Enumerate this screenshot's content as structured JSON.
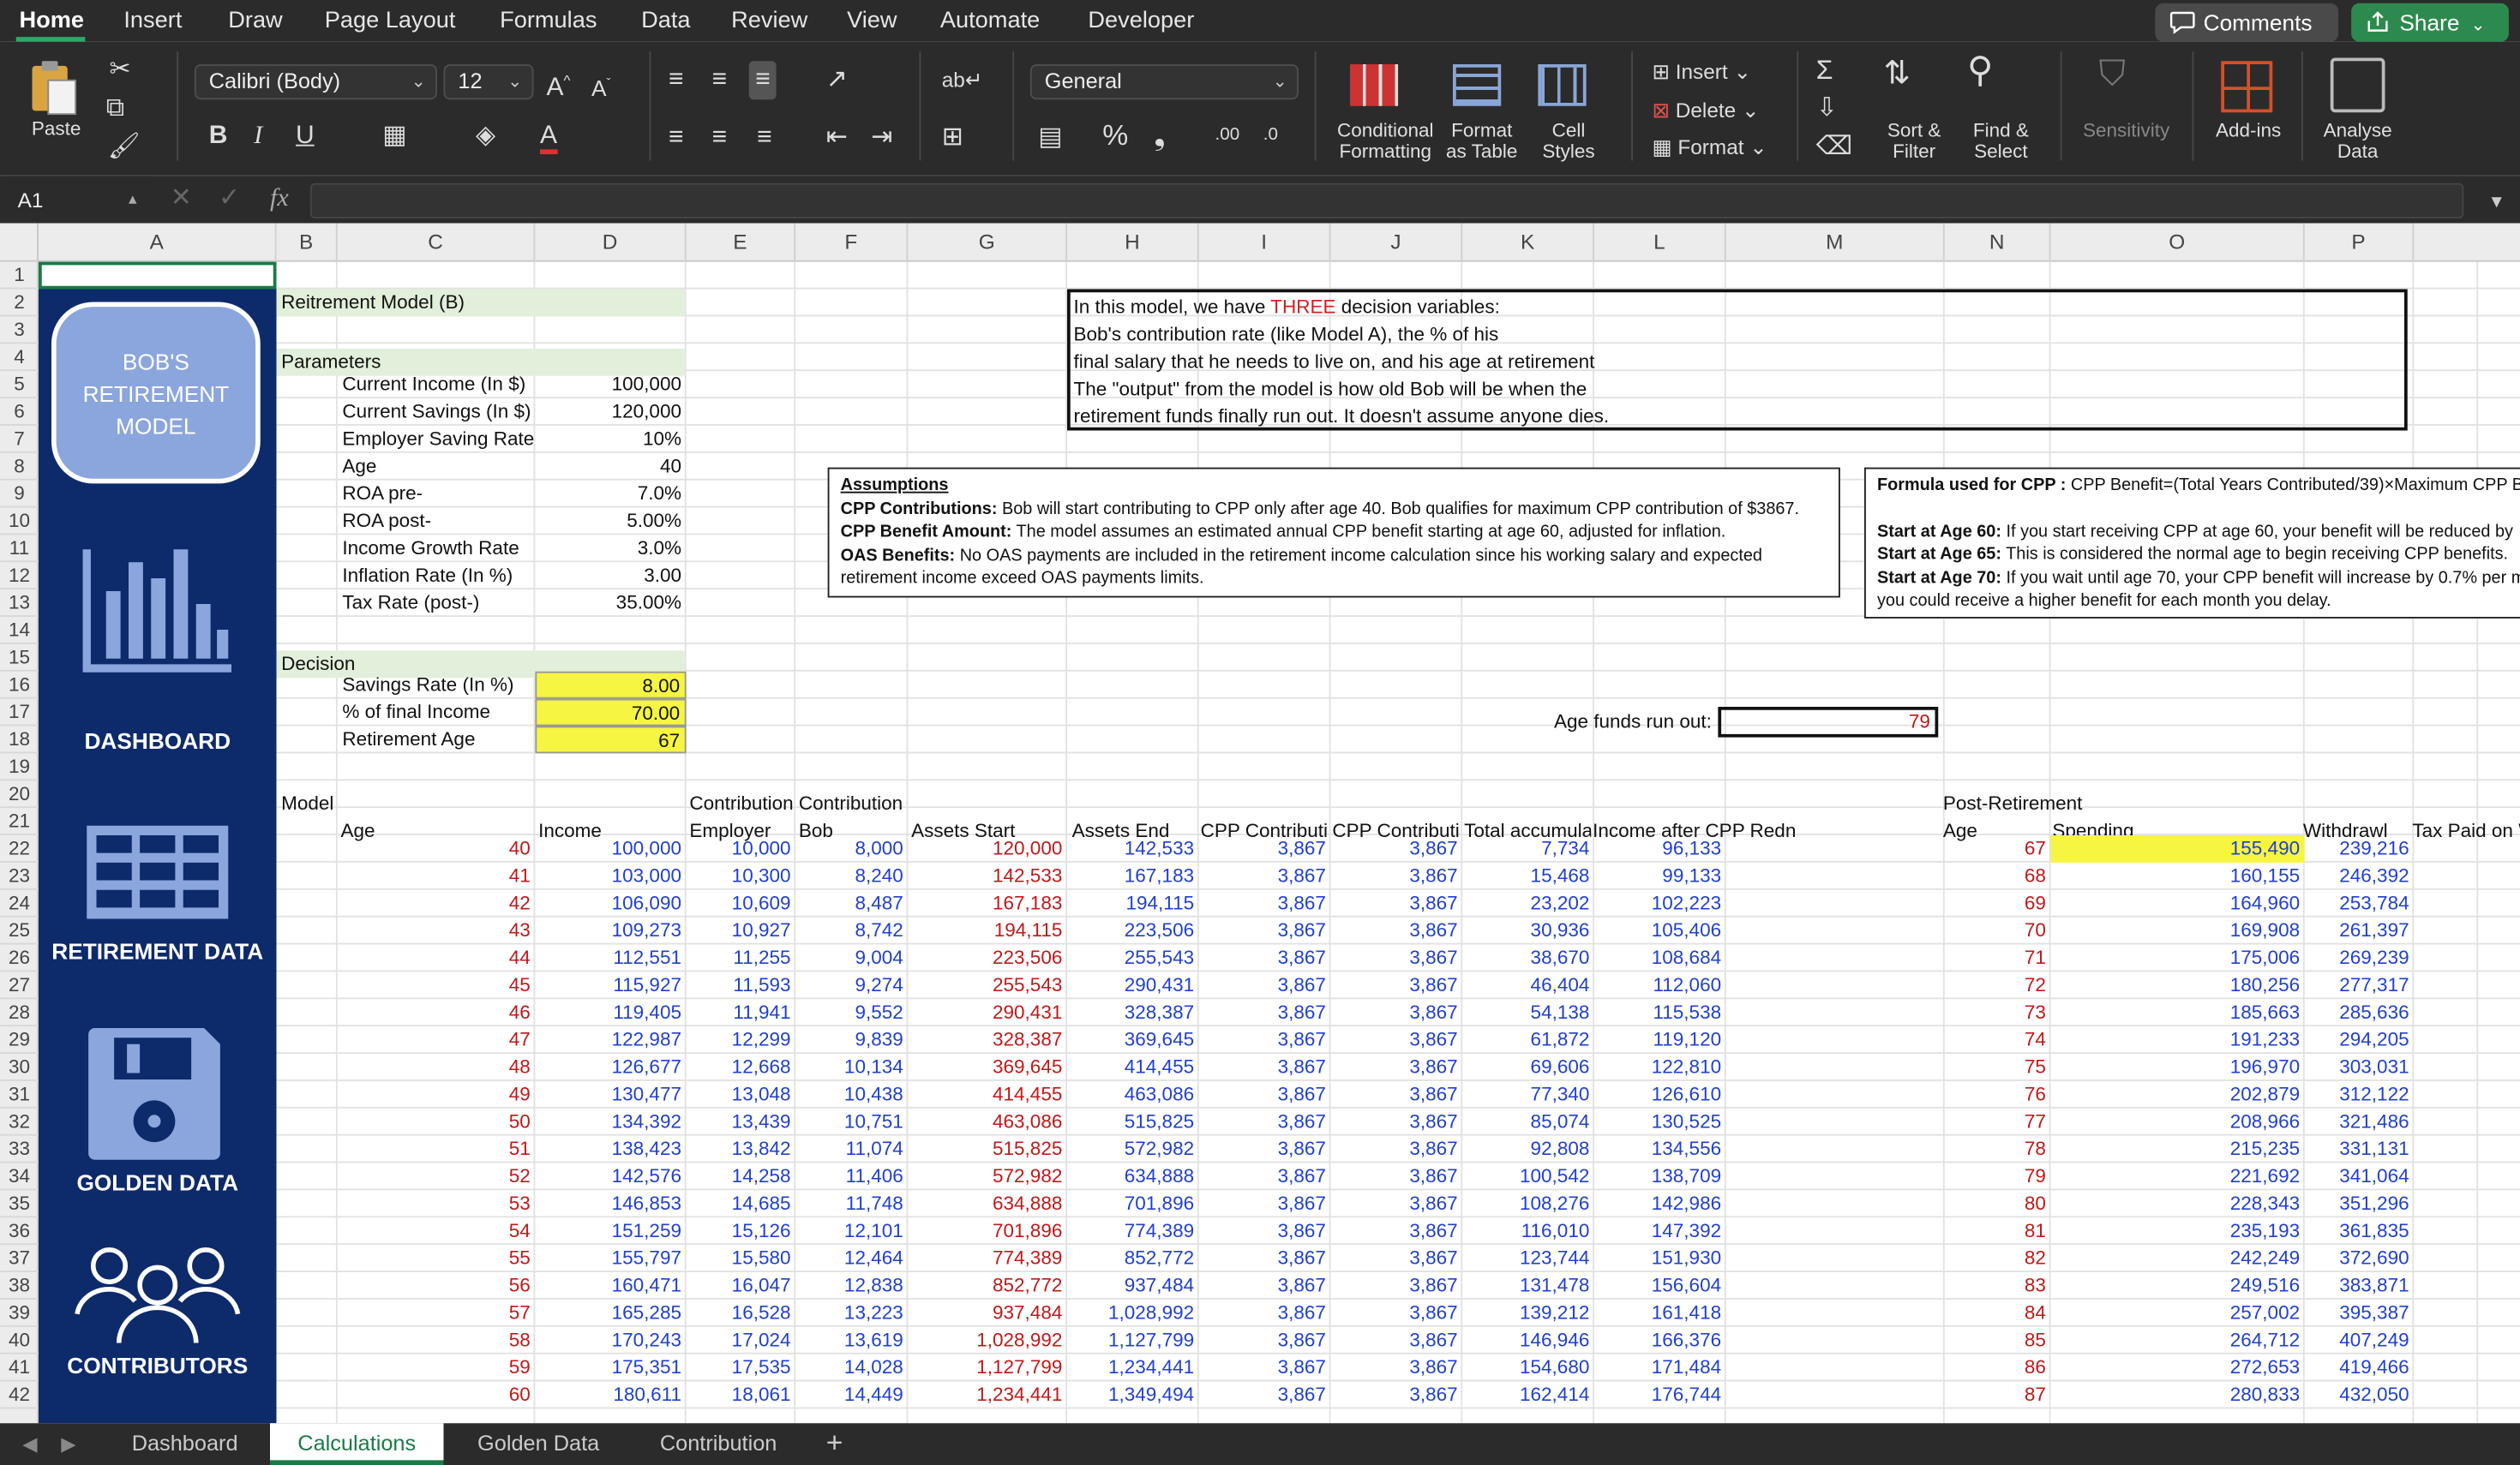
{
  "ribbon_tabs": [
    "Home",
    "Insert",
    "Draw",
    "Page Layout",
    "Formulas",
    "Data",
    "Review",
    "View",
    "Automate",
    "Developer"
  ],
  "top_buttons": {
    "comments": "Comments",
    "share": "Share"
  },
  "ribbon": {
    "paste": "Paste",
    "font_name": "Calibri (Body)",
    "font_size": "12",
    "number_format": "General",
    "cond_fmt": [
      "Conditional",
      "Formatting"
    ],
    "fmt_table": [
      "Format",
      "as Table"
    ],
    "cell_styles": [
      "Cell",
      "Styles"
    ],
    "insert": "Insert",
    "delete": "Delete",
    "format": "Format",
    "sort": [
      "Sort &",
      "Filter"
    ],
    "find": [
      "Find &",
      "Select"
    ],
    "sensitivity": "Sensitivity",
    "addins": "Add-ins",
    "analyse": [
      "Analyse",
      "Data"
    ]
  },
  "formula_bar": {
    "name_box": "A1",
    "fx": "fx",
    "formula": ""
  },
  "columns": [
    "A",
    "B",
    "C",
    "D",
    "E",
    "F",
    "G",
    "H",
    "I",
    "J",
    "K",
    "L",
    "M",
    "N",
    "O",
    "P"
  ],
  "rows": [
    "1",
    "2",
    "3",
    "4",
    "5",
    "6",
    "7",
    "8",
    "9",
    "10",
    "11",
    "12",
    "13",
    "14",
    "15",
    "16",
    "17",
    "18",
    "19",
    "20",
    "21",
    "22",
    "23",
    "24",
    "25",
    "26",
    "27",
    "28",
    "29",
    "30",
    "31",
    "32",
    "33",
    "34",
    "35",
    "36",
    "37",
    "38",
    "39",
    "40",
    "41",
    "42"
  ],
  "sidebar": {
    "title": [
      "BOB'S",
      "RETIREMENT",
      "MODEL"
    ],
    "dashboard": "DASHBOARD",
    "retirement_data": "RETIREMENT DATA",
    "golden_data": "GOLDEN DATA",
    "contributors": "CONTRIBUTORS"
  },
  "model_title": "Reitrement Model (B)",
  "parameters_header": "Parameters",
  "parameters": [
    {
      "label": "Current Income (In $)",
      "value": "100,000"
    },
    {
      "label": "Current Savings (In $)",
      "value": "120,000"
    },
    {
      "label": "Employer Saving Rate",
      "value": "10%"
    },
    {
      "label": "Age",
      "value": "40"
    },
    {
      "label": "ROA pre-",
      "value": "7.0%"
    },
    {
      "label": "ROA post-",
      "value": "5.00%"
    },
    {
      "label": "Income Growth Rate",
      "value": "3.0%"
    },
    {
      "label": "Inflation Rate (In %)",
      "value": "3.00"
    },
    {
      "label": "Tax Rate (post-)",
      "value": "35.00%"
    }
  ],
  "decision_header": "Decision",
  "decisions": [
    {
      "label": "Savings Rate (In %)",
      "value": "8.00"
    },
    {
      "label": "% of final Income",
      "value": "70.00"
    },
    {
      "label": "Retirement Age",
      "value": "67"
    }
  ],
  "note_box": {
    "line1_pre": "In this model, we have ",
    "line1_red": "THREE",
    "line1_post": " decision variables:",
    "lines": [
      "Bob's contribution rate (like Model A), the % of his",
      "final salary that he needs to live on, and his age at retirement",
      "The \"output\" from the model is how old Bob will be when the",
      "retirement funds finally run out. It doesn't assume anyone dies."
    ]
  },
  "assumptions": {
    "title": "Assumptions",
    "cpp_contrib_label": "CPP Contributions:",
    "cpp_contrib": " Bob will start contributing to CPP only after age 40. Bob qualifies for maximum CPP contribution of $3867.",
    "cpp_benefit_label": "CPP Benefit Amount:",
    "cpp_benefit": " The model assumes an estimated annual CPP benefit starting at age 60, adjusted for inflation.",
    "oas_label": "OAS Benefits:",
    "oas": " No OAS payments are included in the retirement income calculation since his working salary and expected",
    "oas2": "retirement income exceed OAS payments limits."
  },
  "formula_box": {
    "title_label": "Formula used for CPP :",
    "title": " CPP Benefit=(Total Years Contributed/39)×Maximum CPP Be",
    "a60_label": "Start at Age 60:",
    "a60": " If you start receiving CPP at age 60, your benefit will be reduced by",
    "a65_label": "Start at Age 65:",
    "a65": " This is considered the normal age to begin receiving CPP benefits.",
    "a70_label": "Start at Age 70:",
    "a70": " If you wait until age 70, your CPP benefit will increase by 0.7% per m",
    "a70b": "you could receive a higher benefit for each month you delay."
  },
  "age_run_out": {
    "label": "Age funds run out:",
    "value": "79"
  },
  "table_headers": {
    "model": "Model",
    "age": "Age",
    "income": "Income",
    "contrib1": "Contribution",
    "contrib2": "Contribution",
    "employer": "Employer",
    "bob": "Bob",
    "assets_start": "Assets Start",
    "assets_end": "Assets End",
    "cpp1": "CPP Contributic",
    "cpp2": "CPP Contributic",
    "total": "Total accumula",
    "income_after": "Income after CPP Redn",
    "post": "Post-Retirement",
    "post_age": "Age",
    "spending": "Spending",
    "withdrawl": "Withdrawl",
    "tax": "Tax Paid on W"
  },
  "table_rows": [
    [
      "40",
      "100,000",
      "10,000",
      "8,000",
      "120,000",
      "142,533",
      "3,867",
      "3,867",
      "7,734",
      "96,133",
      "67",
      "155,490",
      "239,216"
    ],
    [
      "41",
      "103,000",
      "10,300",
      "8,240",
      "142,533",
      "167,183",
      "3,867",
      "3,867",
      "15,468",
      "99,133",
      "68",
      "160,155",
      "246,392"
    ],
    [
      "42",
      "106,090",
      "10,609",
      "8,487",
      "167,183",
      "194,115",
      "3,867",
      "3,867",
      "23,202",
      "102,223",
      "69",
      "164,960",
      "253,784"
    ],
    [
      "43",
      "109,273",
      "10,927",
      "8,742",
      "194,115",
      "223,506",
      "3,867",
      "3,867",
      "30,936",
      "105,406",
      "70",
      "169,908",
      "261,397"
    ],
    [
      "44",
      "112,551",
      "11,255",
      "9,004",
      "223,506",
      "255,543",
      "3,867",
      "3,867",
      "38,670",
      "108,684",
      "71",
      "175,006",
      "269,239"
    ],
    [
      "45",
      "115,927",
      "11,593",
      "9,274",
      "255,543",
      "290,431",
      "3,867",
      "3,867",
      "46,404",
      "112,060",
      "72",
      "180,256",
      "277,317"
    ],
    [
      "46",
      "119,405",
      "11,941",
      "9,552",
      "290,431",
      "328,387",
      "3,867",
      "3,867",
      "54,138",
      "115,538",
      "73",
      "185,663",
      "285,636"
    ],
    [
      "47",
      "122,987",
      "12,299",
      "9,839",
      "328,387",
      "369,645",
      "3,867",
      "3,867",
      "61,872",
      "119,120",
      "74",
      "191,233",
      "294,205"
    ],
    [
      "48",
      "126,677",
      "12,668",
      "10,134",
      "369,645",
      "414,455",
      "3,867",
      "3,867",
      "69,606",
      "122,810",
      "75",
      "196,970",
      "303,031"
    ],
    [
      "49",
      "130,477",
      "13,048",
      "10,438",
      "414,455",
      "463,086",
      "3,867",
      "3,867",
      "77,340",
      "126,610",
      "76",
      "202,879",
      "312,122"
    ],
    [
      "50",
      "134,392",
      "13,439",
      "10,751",
      "463,086",
      "515,825",
      "3,867",
      "3,867",
      "85,074",
      "130,525",
      "77",
      "208,966",
      "321,486"
    ],
    [
      "51",
      "138,423",
      "13,842",
      "11,074",
      "515,825",
      "572,982",
      "3,867",
      "3,867",
      "92,808",
      "134,556",
      "78",
      "215,235",
      "331,131"
    ],
    [
      "52",
      "142,576",
      "14,258",
      "11,406",
      "572,982",
      "634,888",
      "3,867",
      "3,867",
      "100,542",
      "138,709",
      "79",
      "221,692",
      "341,064"
    ],
    [
      "53",
      "146,853",
      "14,685",
      "11,748",
      "634,888",
      "701,896",
      "3,867",
      "3,867",
      "108,276",
      "142,986",
      "80",
      "228,343",
      "351,296"
    ],
    [
      "54",
      "151,259",
      "15,126",
      "12,101",
      "701,896",
      "774,389",
      "3,867",
      "3,867",
      "116,010",
      "147,392",
      "81",
      "235,193",
      "361,835"
    ],
    [
      "55",
      "155,797",
      "15,580",
      "12,464",
      "774,389",
      "852,772",
      "3,867",
      "3,867",
      "123,744",
      "151,930",
      "82",
      "242,249",
      "372,690"
    ],
    [
      "56",
      "160,471",
      "16,047",
      "12,838",
      "852,772",
      "937,484",
      "3,867",
      "3,867",
      "131,478",
      "156,604",
      "83",
      "249,516",
      "383,871"
    ],
    [
      "57",
      "165,285",
      "16,528",
      "13,223",
      "937,484",
      "1,028,992",
      "3,867",
      "3,867",
      "139,212",
      "161,418",
      "84",
      "257,002",
      "395,387"
    ],
    [
      "58",
      "170,243",
      "17,024",
      "13,619",
      "1,028,992",
      "1,127,799",
      "3,867",
      "3,867",
      "146,946",
      "166,376",
      "85",
      "264,712",
      "407,249"
    ],
    [
      "59",
      "175,351",
      "17,535",
      "14,028",
      "1,127,799",
      "1,234,441",
      "3,867",
      "3,867",
      "154,680",
      "171,484",
      "86",
      "272,653",
      "419,466"
    ],
    [
      "60",
      "180,611",
      "18,061",
      "14,449",
      "1,234,441",
      "1,349,494",
      "3,867",
      "3,867",
      "162,414",
      "176,744",
      "87",
      "280,833",
      "432,050"
    ]
  ],
  "sheet_tabs": [
    "Dashboard",
    "Calculations",
    "Golden Data",
    "Contribution"
  ],
  "colors": {
    "accent": "#1a7a47",
    "sidebar": "#0d2a6b",
    "yellow": "#f5f542",
    "label_green": "#e2efda",
    "blue_text": "#1f3fcf",
    "red_text": "#c01818"
  }
}
